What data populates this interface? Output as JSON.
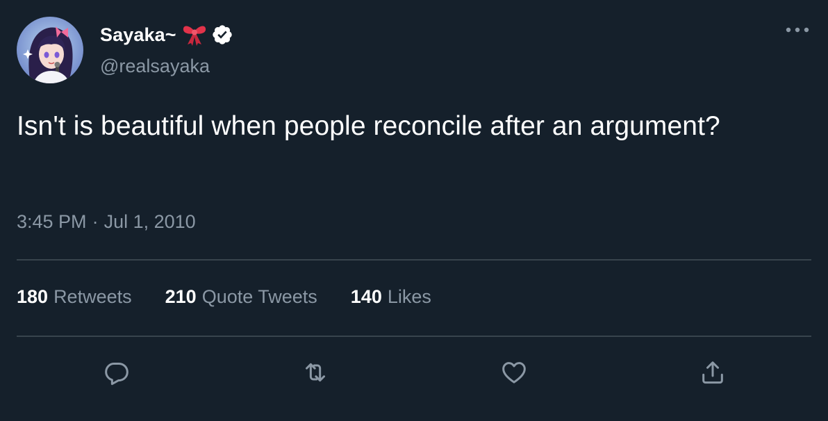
{
  "tweet": {
    "author": {
      "display_name": "Sayaka~",
      "handle": "@realsayaka",
      "name_emoji": "ribbon-icon",
      "verified": true
    },
    "text": "Isn't is beautiful when people reconcile after an argument?",
    "time": "3:45 PM",
    "separator": "·",
    "date": "Jul 1, 2010"
  },
  "stats": {
    "retweets": {
      "count": "180",
      "label": "Retweets"
    },
    "quote_tweets": {
      "count": "210",
      "label": "Quote Tweets"
    },
    "likes": {
      "count": "140",
      "label": "Likes"
    }
  },
  "actions": [
    "reply-icon",
    "retweet-icon",
    "like-icon",
    "share-icon"
  ],
  "colors": {
    "background": "#15202b",
    "primary_text": "#ffffff",
    "secondary_text": "#8b98a5",
    "divider": "#38444d",
    "icon": "#8b98a5",
    "ribbon": "#e2334a"
  }
}
